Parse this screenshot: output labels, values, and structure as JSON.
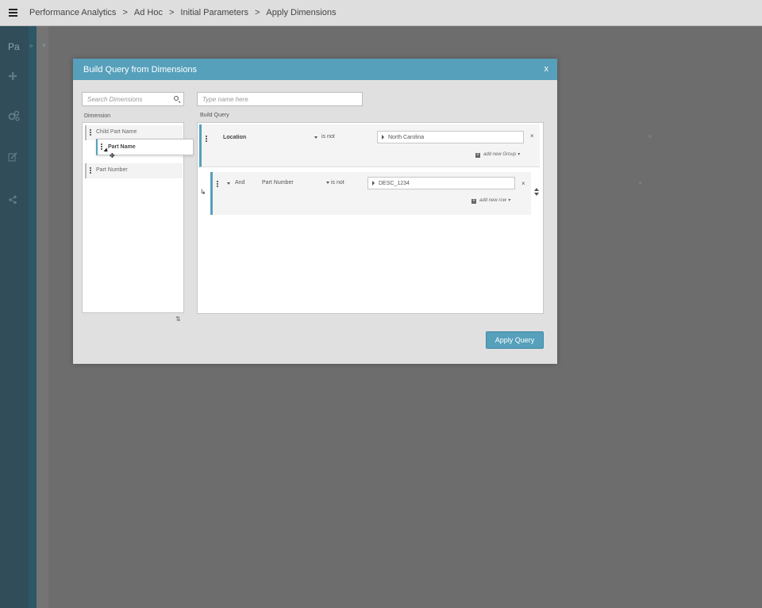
{
  "breadcrumb": [
    "Performance Analytics",
    "Ad Hoc",
    "Initial Parameters",
    "Apply Dimensions"
  ],
  "breadcrumb_separator": ">",
  "nav": {
    "title": "Pa",
    "arrows": "» ▼"
  },
  "modal": {
    "title": "Build Query from Dimensions",
    "close": "x",
    "search_placeholder": "Search Dimensions",
    "name_placeholder": "Type name here",
    "dimension_label": "Dimension",
    "build_query_label": "Build Query",
    "apply_label": "Apply Query"
  },
  "dimensions": [
    "Child Part Name",
    "Part Number"
  ],
  "dragging_item": "Part Name",
  "query": {
    "group": {
      "field": "Location",
      "operator": "is not",
      "value": "North Carolina",
      "add_label": "add new Group"
    },
    "row": {
      "conjunction": "And",
      "field": "Part Number",
      "operator": "is not",
      "value": "DESC_1234",
      "add_label": "add new row"
    }
  },
  "icons": {
    "close": "×",
    "return_arrow": "↳",
    "move": "✥",
    "sort": "⇅"
  },
  "colors": {
    "accent": "#56a0bb",
    "nav": "#314d5a",
    "overlay": "#6e6e6e"
  }
}
